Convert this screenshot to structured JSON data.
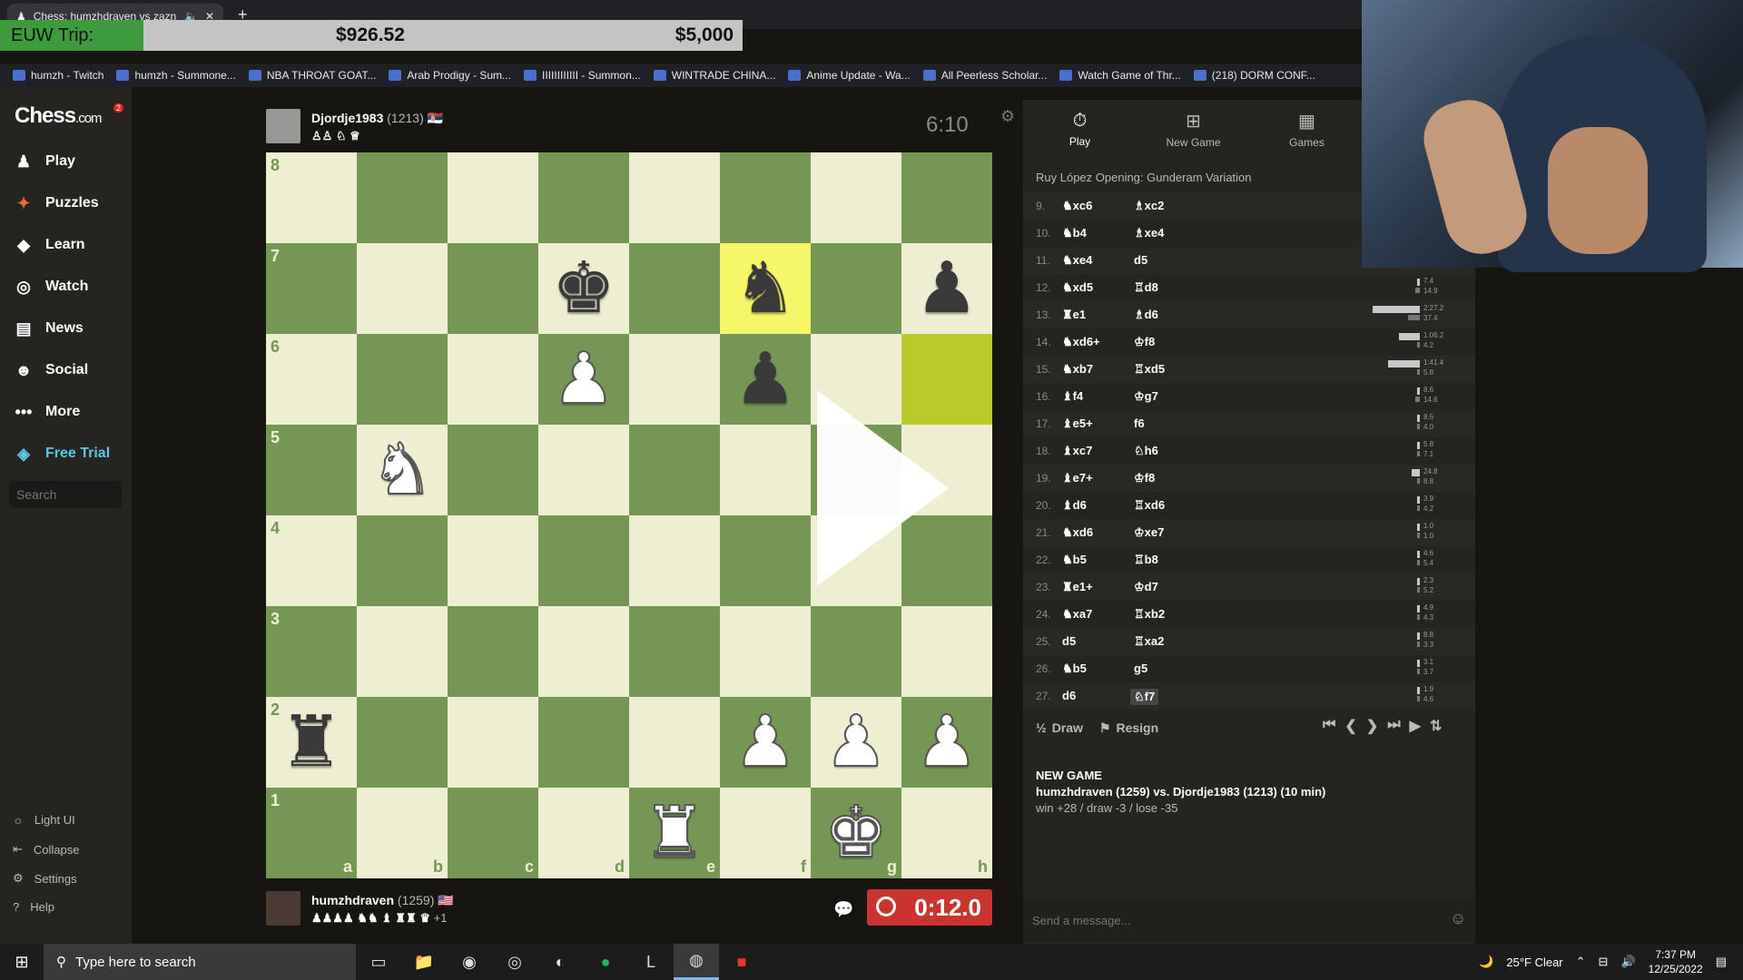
{
  "browser": {
    "tab_title": "Chess: humzhdraven vs zazn",
    "new_tab": "+",
    "bookmarks": [
      "humzh - Twitch",
      "humzh - Summone...",
      "NBA THROAT GOAT...",
      "Arab Prodigy - Sum...",
      "IIIIIIIIIIII - Summon...",
      "WINTRADE CHINA...",
      "Anime Update - Wa...",
      "All Peerless Scholar...",
      "Watch Game of Thr...",
      "(218) DORM CONF..."
    ]
  },
  "overlay": {
    "label": "EUW Trip:",
    "current": "$926.52",
    "goal": "$5,000",
    "progress": 0.185
  },
  "sidebar": {
    "logo": "Chess",
    "logo_suffix": ".com",
    "badge": "2",
    "items": [
      {
        "label": "Play",
        "icon": "pawn-icon"
      },
      {
        "label": "Puzzles",
        "icon": "puzzle-icon"
      },
      {
        "label": "Learn",
        "icon": "learn-icon"
      },
      {
        "label": "Watch",
        "icon": "binoculars-icon"
      },
      {
        "label": "News",
        "icon": "news-icon"
      },
      {
        "label": "Social",
        "icon": "social-icon"
      },
      {
        "label": "More",
        "icon": "more-icon"
      },
      {
        "label": "Free Trial",
        "icon": "diamond-icon"
      }
    ],
    "search_placeholder": "Search",
    "bottom": [
      {
        "label": "Light UI",
        "icon": "sun-icon"
      },
      {
        "label": "Collapse",
        "icon": "collapse-icon"
      },
      {
        "label": "Settings",
        "icon": "gear-icon"
      },
      {
        "label": "Help",
        "icon": "help-icon"
      }
    ]
  },
  "opponent": {
    "name": "Djordje1983",
    "rating": "(1213)",
    "clock": "6:10"
  },
  "player": {
    "name": "humzhdraven",
    "rating": "(1259)",
    "clock": "0:12.0",
    "captured_extra": "+1"
  },
  "board": {
    "files": [
      "a",
      "b",
      "c",
      "d",
      "e",
      "f",
      "g",
      "h"
    ],
    "ranks": [
      "8",
      "7",
      "6",
      "5",
      "4",
      "3",
      "2",
      "1"
    ],
    "pieces": [
      {
        "sq": "d7",
        "p": "♚",
        "c": "b"
      },
      {
        "sq": "f7",
        "p": "♞",
        "c": "b"
      },
      {
        "sq": "h7",
        "p": "♟",
        "c": "b"
      },
      {
        "sq": "d6",
        "p": "♟",
        "c": "w"
      },
      {
        "sq": "f6",
        "p": "♟",
        "c": "b"
      },
      {
        "sq": "b5",
        "p": "♞",
        "c": "w"
      },
      {
        "sq": "a2",
        "p": "♜",
        "c": "b"
      },
      {
        "sq": "f2",
        "p": "♟",
        "c": "w"
      },
      {
        "sq": "g2",
        "p": "♟",
        "c": "w"
      },
      {
        "sq": "h2",
        "p": "♟",
        "c": "w"
      },
      {
        "sq": "e1",
        "p": "♜",
        "c": "w"
      },
      {
        "sq": "g1",
        "p": "♚",
        "c": "w"
      }
    ],
    "highlights": [
      "f7",
      "h6"
    ]
  },
  "panel": {
    "tabs": [
      {
        "label": "Play",
        "icon": "stopwatch-icon"
      },
      {
        "label": "New Game",
        "icon": "plus-icon"
      },
      {
        "label": "Games",
        "icon": "board-icon"
      }
    ],
    "opening": "Ruy López Opening: Gunderam Variation",
    "moves": [
      {
        "n": "9.",
        "w": "♞xc6",
        "b": "♗xc2"
      },
      {
        "n": "10.",
        "w": "♞b4",
        "b": "♗xe4"
      },
      {
        "n": "11.",
        "w": "♞xe4",
        "b": "d5"
      },
      {
        "n": "12.",
        "w": "♞xd5",
        "b": "♖d8"
      },
      {
        "n": "13.",
        "w": "♜e1",
        "b": "♗d6"
      },
      {
        "n": "14.",
        "w": "♞xd6+",
        "b": "♔f8"
      },
      {
        "n": "15.",
        "w": "♞xb7",
        "b": "♖xd5"
      },
      {
        "n": "16.",
        "w": "♝f4",
        "b": "♔g7"
      },
      {
        "n": "17.",
        "w": "♝e5+",
        "b": "f6"
      },
      {
        "n": "18.",
        "w": "♝xc7",
        "b": "♘h6"
      },
      {
        "n": "19.",
        "w": "♝e7+",
        "b": "♔f8"
      },
      {
        "n": "20.",
        "w": "♝d6",
        "b": "♖xd6"
      },
      {
        "n": "21.",
        "w": "♞xd6",
        "b": "♔xe7"
      },
      {
        "n": "22.",
        "w": "♞b5",
        "b": "♖b8"
      },
      {
        "n": "23.",
        "w": "♜e1+",
        "b": "♔d7"
      },
      {
        "n": "24.",
        "w": "♞xa7",
        "b": "♖xb2"
      },
      {
        "n": "25.",
        "w": "d5",
        "b": "♖xa2"
      },
      {
        "n": "26.",
        "w": "♞b5",
        "b": "g5"
      },
      {
        "n": "27.",
        "w": "d6",
        "b": "♘f7"
      }
    ],
    "times": [
      [
        "",
        ""
      ],
      [
        "",
        ""
      ],
      [
        "",
        ""
      ],
      [
        "7.4",
        "14.9"
      ],
      [
        "2:27.2",
        "37.4"
      ],
      [
        "1:06.2",
        "4.2"
      ],
      [
        "1:41.4",
        "5.8"
      ],
      [
        "8.6",
        "14.6"
      ],
      [
        "8.5",
        "4.0"
      ],
      [
        "5.8",
        "7.1"
      ],
      [
        "24.8",
        "8.8"
      ],
      [
        "3.9",
        "4.2"
      ],
      [
        "1.0",
        "1.0"
      ],
      [
        "4.6",
        "5.4"
      ],
      [
        "2.3",
        "5.2"
      ],
      [
        "4.9",
        "4.3"
      ],
      [
        "8.8",
        "3.3"
      ],
      [
        "3.1",
        "3.7"
      ],
      [
        "1.9",
        "4.6"
      ]
    ],
    "draw": "Draw",
    "resign": "Resign",
    "new_game_title": "NEW GAME",
    "new_game_players": "humzhdraven (1259) vs. Djordje1983 (1213) (10 min)",
    "new_game_stats": "win +28 / draw -3 / lose -35",
    "message_placeholder": "Send a message..."
  },
  "taskbar": {
    "search": "Type here to search",
    "weather": "25°F  Clear",
    "time": "7:37 PM",
    "date": "12/25/2022"
  }
}
